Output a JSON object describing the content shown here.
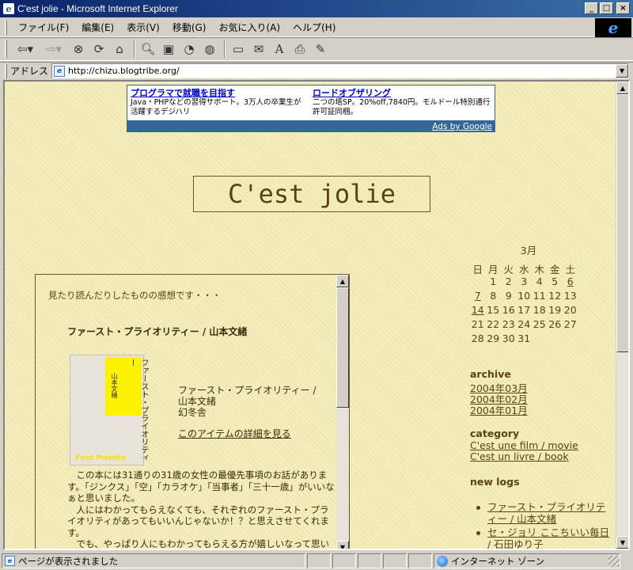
{
  "window": {
    "title": "C'est jolie - Microsoft Internet Explorer",
    "icon": "ie-page-icon",
    "controls": [
      "minimize",
      "maximize",
      "close"
    ]
  },
  "menu": {
    "items": [
      "ファイル(F)",
      "編集(E)",
      "表示(V)",
      "移動(G)",
      "お気に入り(A)",
      "ヘルプ(H)"
    ]
  },
  "toolbar": {
    "icons": [
      "back-icon",
      "forward-icon",
      "stop-icon",
      "refresh-icon",
      "home-icon",
      "search-icon",
      "favorites-icon",
      "history-icon",
      "channels-icon",
      "fullscreen-icon",
      "mail-icon",
      "font-icon",
      "print-icon",
      "edit-icon"
    ]
  },
  "address": {
    "label": "アドレス",
    "url": "http://chizu.blogtribe.org/"
  },
  "ad": {
    "left_title": "プログラマで就職を目指す",
    "left_text": "Java・PHPなどの習得サポート。3万人の卒業生が活躍するデジハリ",
    "right_title": "ロードオブザリング",
    "right_text": "二つの塔SP。20%off,7840円。モルドール特別通行許可証同梱。",
    "footer": "Ads by Google"
  },
  "site": {
    "title": "C'est jolie"
  },
  "calendar": {
    "month": "3月",
    "weekdays": [
      "日",
      "月",
      "火",
      "水",
      "木",
      "金",
      "土"
    ],
    "weeks": [
      [
        "",
        "1",
        "2",
        "3",
        "4",
        "5",
        "6"
      ],
      [
        "7",
        "8",
        "9",
        "10",
        "11",
        "12",
        "13"
      ],
      [
        "14",
        "15",
        "16",
        "17",
        "18",
        "19",
        "20"
      ],
      [
        "21",
        "22",
        "23",
        "24",
        "25",
        "26",
        "27"
      ],
      [
        "28",
        "29",
        "30",
        "31",
        "",
        "",
        ""
      ]
    ],
    "linked_days": [
      "6",
      "7",
      "14"
    ]
  },
  "sidebar": {
    "archive_heading": "archive",
    "archive": [
      "2004年03月",
      "2004年02月",
      "2004年01月"
    ],
    "category_heading": "category",
    "categories": [
      "C'est une film / movie",
      "C'est un livre / book"
    ],
    "newlogs_heading": "new logs",
    "newlogs": [
      "ファースト・プライオリティー / 山本文緒",
      "セ・ジョリ ここちいい毎日 / 石田ゆり子"
    ]
  },
  "main": {
    "intro": "見たり読んだりしたものの感想です・・・",
    "post_title": "ファースト・プライオリティー / 山本文緒",
    "cover": {
      "title_vertical": "ファースト・プライオリティー",
      "author_vertical": "山本文緒",
      "english": "First Priority"
    },
    "book_meta": [
      "ファースト・プライオリティー /",
      "山本文緒",
      "幻冬舎"
    ],
    "details_link": "このアイテムの詳細を見る",
    "body": [
      "この本には31通りの31歳の女性の最優先事項のお話があります。「ジンクス」「空」「カラオケ」「当事者」「三十一歳」がいいなぁと思いました。",
      "人にはわかってもらえなくても、それぞれのファースト・プライオリティがあってもいいんじゃないか！？と思えさせてくれます。",
      "でも、やっぱり人にもわかってもらえる方が嬉しいなって思いました。"
    ]
  },
  "status": {
    "text": "ページが表示されました",
    "zone": "インターネット ゾーン"
  }
}
